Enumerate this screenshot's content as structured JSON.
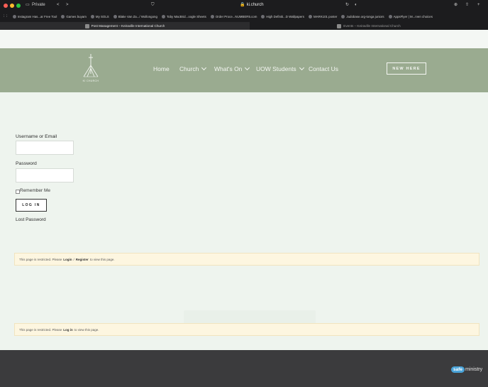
{
  "browser": {
    "private_label": "Private",
    "url": "ki.church",
    "bookmarks": [
      "Instagram Has...ar Free Tool",
      "Games buyam",
      "My SOLS",
      "Blake Van Za.../ Wollongong",
      "Toby MacBrid...oogle Sheets",
      "Order Proce...NUMBER5.com",
      "High Definiti...D Wallpapers",
      "MARK101 poster",
      "Judobase.org-tonga juniors",
      "AppsFlyer | M...rven choices"
    ],
    "tabs": [
      {
        "label": "Post Management – Keiraville International Church",
        "active": true
      },
      {
        "label": "Events – Keiraville International Church",
        "active": false
      }
    ]
  },
  "header": {
    "logo_text": "KI CHURCH",
    "nav": [
      {
        "label": "Home",
        "dropdown": false
      },
      {
        "label": "Church",
        "dropdown": true
      },
      {
        "label": "What's On",
        "dropdown": true
      },
      {
        "label": "UOW Students",
        "dropdown": true
      },
      {
        "label": "Contact Us",
        "dropdown": false
      }
    ],
    "cta": "NEW HERE"
  },
  "login": {
    "username_label": "Username or Email",
    "username_value": "",
    "password_label": "Password",
    "password_value": "",
    "remember_label": "Remember Me",
    "remember_checked": false,
    "login_button": "LOG IN",
    "lost_password": "Lost Password"
  },
  "notice1": {
    "prefix": "This page is restricted. Please",
    "login": "Login",
    "sep": "/",
    "register": "Register",
    "suffix": "to view this page."
  },
  "notice2": {
    "prefix": "This page is restricted. Please",
    "login": "Log in",
    "suffix": "to view this page."
  },
  "footer": {
    "safe_prefix": "safe",
    "safe_suffix": "ministry"
  },
  "colors": {
    "header_bg": "#9aab90",
    "page_bg": "#eef4ee",
    "notice_bg": "#fdf6e0",
    "footer_bg": "#3b3b3d"
  }
}
